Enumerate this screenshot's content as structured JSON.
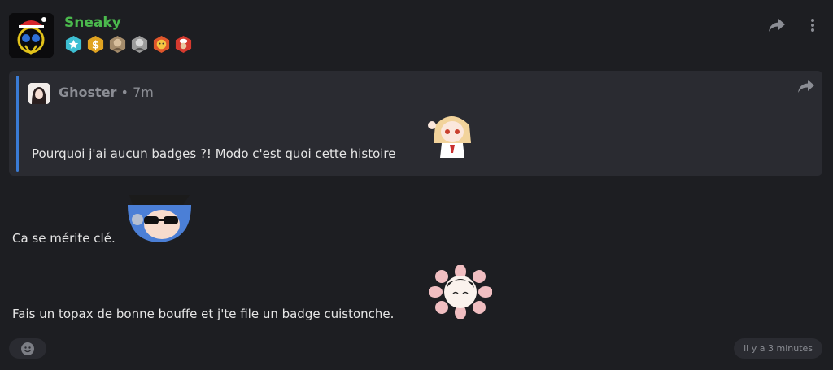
{
  "post": {
    "author": "Sneaky",
    "author_color": "#4bb94d",
    "badges": [
      "star-badge",
      "dollar-badge",
      "portrait-badge-1",
      "portrait-badge-2",
      "face-badge",
      "chef-badge"
    ],
    "actions": [
      "share-icon",
      "more-icon"
    ]
  },
  "quote": {
    "author": "Ghoster",
    "separator": "•",
    "time": "7m",
    "text": "Pourquoi j'ai aucun badges ?! Modo c'est quoi cette histoire",
    "accent": "#3a7bd5"
  },
  "message": {
    "line1": "Ca se mérite clé.",
    "line2": "Fais un topax de bonne bouffe et j'te file un badge cuistonche."
  },
  "footer": {
    "timestamp": "il y a 3 minutes"
  }
}
